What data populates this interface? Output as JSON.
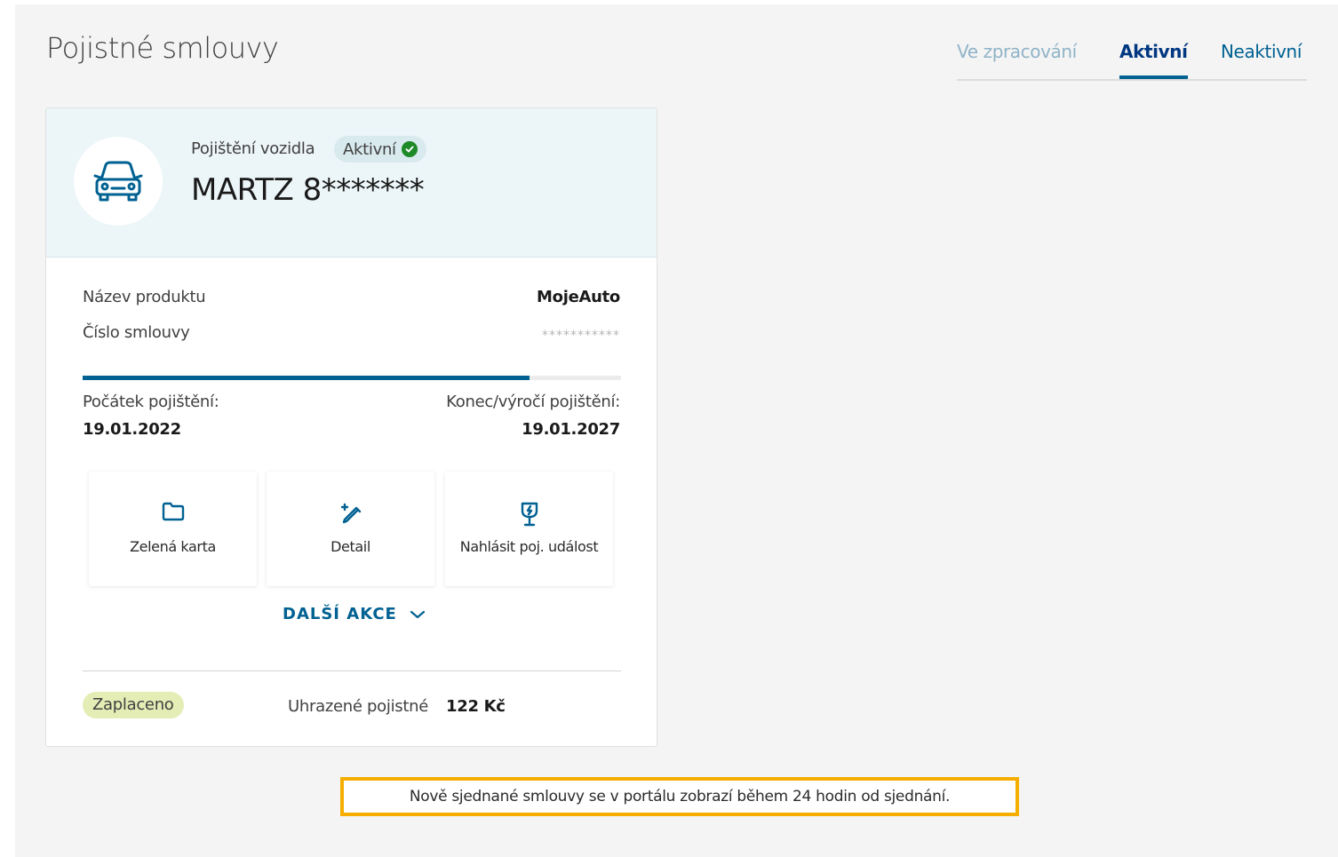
{
  "page": {
    "title": "Pojistné smlouvy"
  },
  "tabs": [
    {
      "label": "Ve zpracování",
      "active": false
    },
    {
      "label": "Aktivní",
      "active": true
    },
    {
      "label": "Neaktivní",
      "active": false
    }
  ],
  "card": {
    "icon": "car-icon",
    "insurance_type": "Pojištění vozidla",
    "status": "Aktivní",
    "plate": "MARTZ 8*******",
    "product_label": "Název produktu",
    "product_value": "MojeAuto",
    "contract_label": "Číslo smlouvy",
    "contract_value": "***********",
    "progress_percent": 83,
    "start_label": "Počátek pojištění:",
    "start_value": "19.01.2022",
    "end_label": "Konec/výročí pojištění:",
    "end_value": "19.01.2027",
    "actions": [
      {
        "label": "Zelená karta",
        "icon": "folder-icon"
      },
      {
        "label": "Detail",
        "icon": "edit-icon"
      },
      {
        "label": "Nahlásit poj. událost",
        "icon": "report-claim-icon"
      }
    ],
    "more_actions": "DALŠÍ AKCE",
    "payment_status": "Zaplaceno",
    "premium_label": "Uhrazené pojistné",
    "premium_value": "122 Kč"
  },
  "notice": "Nově sjednané smlouvy se v portálu zobrazí během 24 hodin od sjednání.",
  "colors": {
    "primary": "#006192",
    "dark_blue": "#003781",
    "active_green": "#1e8927",
    "paid_badge": "#e4edb5",
    "notice_border": "#f5ae00"
  }
}
